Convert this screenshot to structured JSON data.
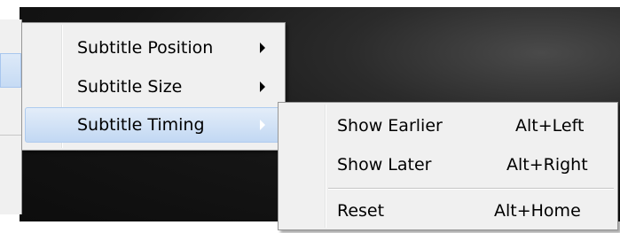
{
  "submenu": {
    "items": [
      {
        "label": "Subtitle Position"
      },
      {
        "label": "Subtitle Size"
      },
      {
        "label": "Subtitle Timing"
      }
    ]
  },
  "timing_menu": {
    "items": [
      {
        "label": "Show Earlier",
        "shortcut": "Alt+Left"
      },
      {
        "label": "Show Later",
        "shortcut": "Alt+Right"
      },
      {
        "label": "Reset",
        "shortcut": "Alt+Home"
      }
    ]
  },
  "colors": {
    "menu_background": "#f0f0f0",
    "highlight": "#c2d8f3",
    "border": "#979797"
  }
}
